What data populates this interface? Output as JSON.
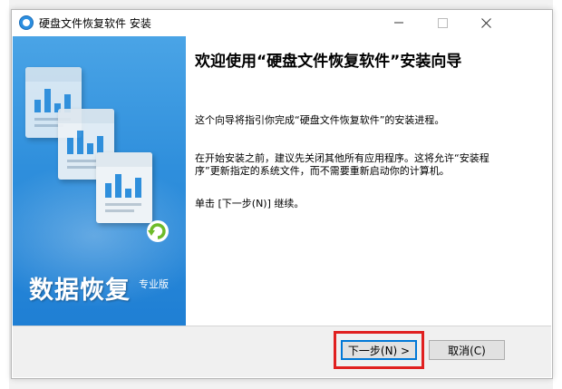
{
  "window": {
    "title": "硬盘文件恢复软件 安装",
    "minimize": "—",
    "close": "✕"
  },
  "sidebar": {
    "logo_text": "数据恢复",
    "logo_sub": "专业版"
  },
  "content": {
    "heading": "欢迎使用“硬盘文件恢复软件”安装向导",
    "para1": "这个向导将指引你完成“硬盘文件恢复软件”的安装进程。",
    "para2": "在开始安装之前，建议先关闭其他所有应用程序。这将允许“安装程序”更新指定的系统文件，而不需要重新启动你的计算机。",
    "para3": "单击 [下一步(N)] 继续。"
  },
  "buttons": {
    "next": "下一步(N) >",
    "cancel": "取消(C)"
  },
  "colors": {
    "accent": "#0078d7",
    "highlight": "#e02020",
    "sidebar": "#2f8fdc"
  }
}
